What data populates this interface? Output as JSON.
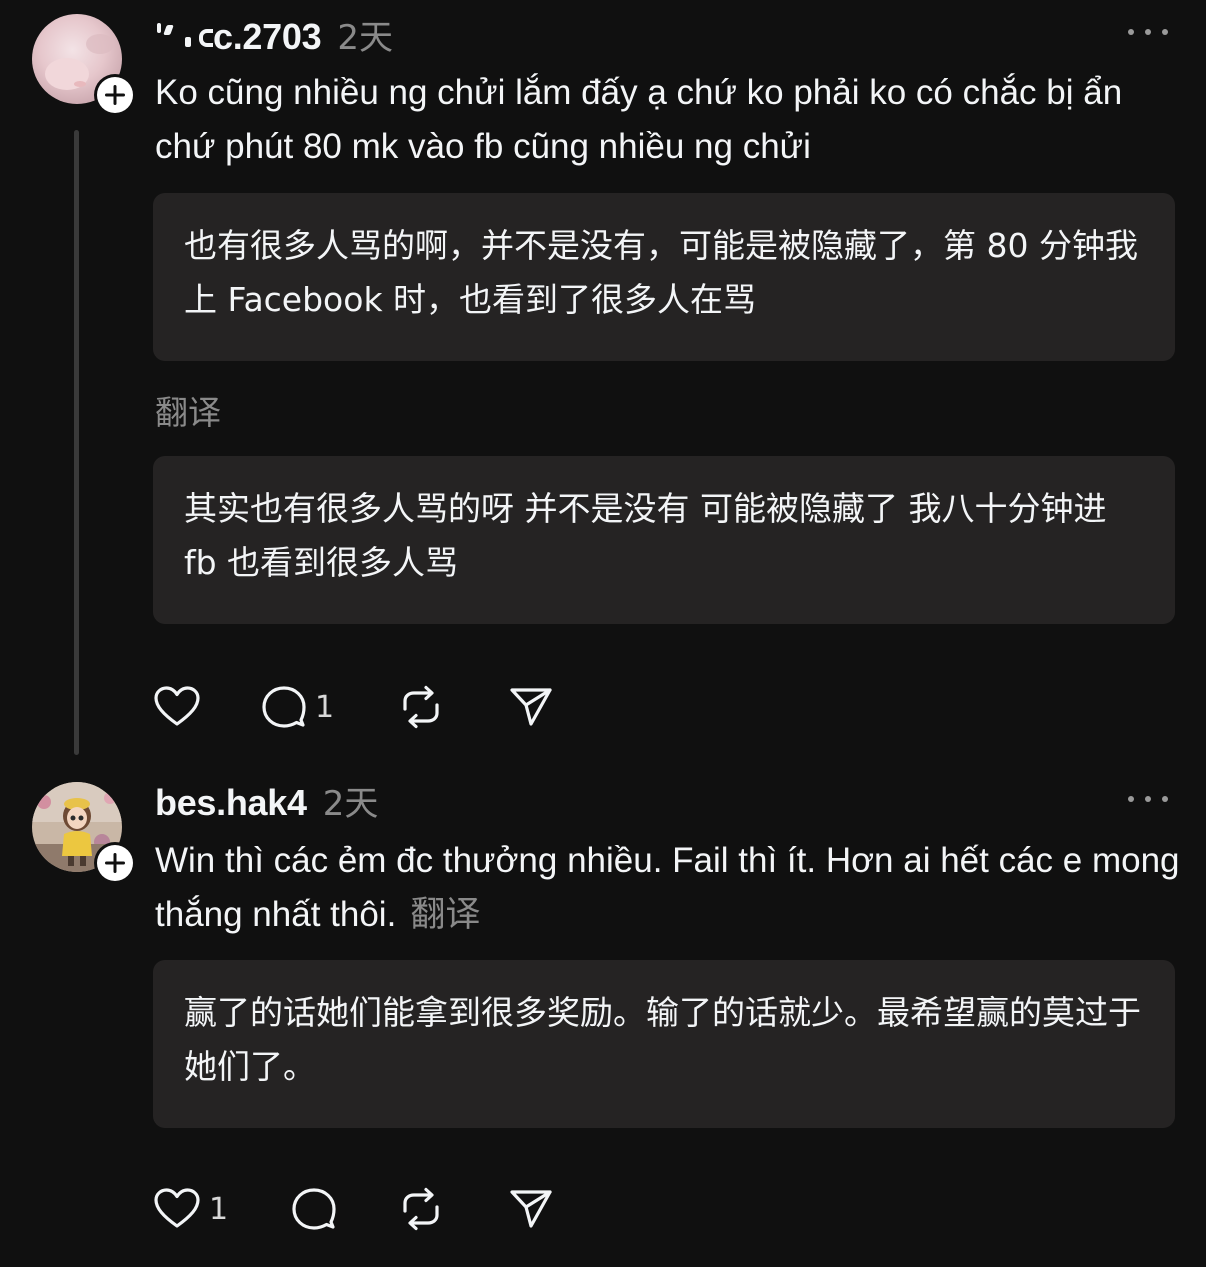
{
  "posts": [
    {
      "username_visible": "c.2703",
      "time": "2天",
      "body": "Ko cũng nhiều ng chửi lắm đấy ạ chứ ko phải ko có chắc bị ẩn chứ phút 80 mk vào fb cũng nhiều ng chửi",
      "translation_primary": "也有很多人骂的啊，并不是没有，可能是被隐藏了，第 80 分钟我上 Facebook 时，也看到了很多人在骂",
      "translate_label": "翻译",
      "translation_secondary": "其实也有很多人骂的呀 并不是没有 可能被隐藏了 我八十分钟进 fb 也看到很多人骂",
      "actions": {
        "like_count": "",
        "reply_count": "1",
        "repost_count": "",
        "share_count": ""
      },
      "avatar_icon": "avatar-pink-photo",
      "follow_icon": "plus-icon"
    },
    {
      "username": "bes.hak4",
      "time": "2天",
      "body": "Win thì các ẻm đc thưởng nhiều. Fail thì ít. Hơn ai hết các e mong thắng nhất thôi.",
      "translate_label": "翻译",
      "translation_primary": "赢了的话她们能拿到很多奖励。输了的话就少。最希望赢的莫过于她们了。",
      "actions": {
        "like_count": "1",
        "reply_count": "",
        "repost_count": "",
        "share_count": ""
      },
      "avatar_icon": "avatar-cartoon-girl",
      "follow_icon": "plus-icon"
    }
  ],
  "colors": {
    "background": "#101010",
    "text": "#f3f5f7",
    "muted": "#8a8a8a",
    "translation_box": "#252323",
    "thread_line": "#3a3a3a"
  },
  "icons": [
    "heart-icon",
    "comment-icon",
    "repost-icon",
    "share-icon",
    "more-icon",
    "plus-icon"
  ]
}
